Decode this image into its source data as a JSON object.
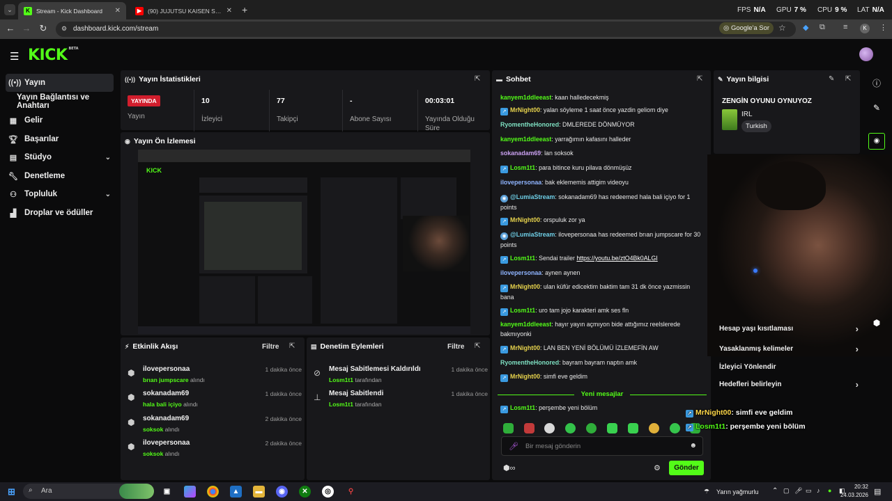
{
  "browser": {
    "tabs": [
      {
        "title": "Stream - Kick Dashboard",
        "favicon": "K",
        "active": true
      },
      {
        "title": "(90) JUJUTSU KAISEN Sendai Co...",
        "favicon": "youtube-icon",
        "active": false
      }
    ],
    "perf": [
      {
        "label": "FPS",
        "value": "N/A"
      },
      {
        "label": "GPU",
        "value": "7 %"
      },
      {
        "label": "CPU",
        "value": "9 %"
      },
      {
        "label": "LAT",
        "value": "N/A"
      }
    ],
    "url": "dashboard.kick.com/stream",
    "google_button": "Google'a Sor",
    "profile_initial": "K"
  },
  "app": {
    "logo": "KICK",
    "logo_badge": "BETA",
    "sidebar": [
      {
        "label": "Yayın",
        "icon": "broadcast-icon",
        "active": true
      },
      {
        "label": "Yayın Bağlantısı ve Anahtarı",
        "icon": "",
        "active": false
      },
      {
        "label": "Gelir",
        "icon": "revenue-icon",
        "active": false
      },
      {
        "label": "Başarılar",
        "icon": "trophy-icon",
        "active": false
      },
      {
        "label": "Stüdyo",
        "icon": "studio-icon",
        "active": false,
        "expandable": true
      },
      {
        "label": "Denetleme",
        "icon": "wrench-icon",
        "active": false
      },
      {
        "label": "Topluluk",
        "icon": "community-icon",
        "active": false,
        "expandable": true
      },
      {
        "label": "Droplar ve ödüller",
        "icon": "drops-icon",
        "active": false
      }
    ],
    "stats": {
      "title": "Yayın İstatistikleri",
      "live_badge": "YAYINDA",
      "columns": [
        {
          "value": "",
          "label": "Yayın"
        },
        {
          "value": "10",
          "label": "İzleyici"
        },
        {
          "value": "77",
          "label": "Takipçi"
        },
        {
          "value": "-",
          "label": "Abone Sayısı"
        },
        {
          "value": "00:03:01",
          "label": "Yayında Olduğu Süre"
        }
      ]
    },
    "preview": {
      "title": "Yayın Ön İzlemesi"
    },
    "activity": {
      "title": "Etkinlik Akışı",
      "filter": "Filtre",
      "items": [
        {
          "user": "ilovepersonaa",
          "reward": "brıan jumpscare",
          "suffix": "alındı",
          "time": "1 dakika önce"
        },
        {
          "user": "sokanadam69",
          "reward": "hala bali içiyo",
          "suffix": "alındı",
          "time": "1 dakika önce"
        },
        {
          "user": "sokanadam69",
          "reward": "soksok",
          "suffix": "alındı",
          "time": "2 dakika önce"
        },
        {
          "user": "ilovepersonaa",
          "reward": "soksok",
          "suffix": "alındı",
          "time": "2 dakika önce"
        }
      ]
    },
    "moderation": {
      "title": "Denetim Eylemleri",
      "filter": "Filtre",
      "items": [
        {
          "action": "Mesaj Sabitlemesi Kaldırıldı",
          "user": "Losm1t1",
          "suffix": "tarafından",
          "time": "1 dakika önce",
          "icon": "unpin-icon"
        },
        {
          "action": "Mesaj Sabitlendi",
          "user": "Losm1t1",
          "suffix": "tarafından",
          "time": "1 dakika önce",
          "icon": "pin-icon"
        }
      ]
    },
    "chat": {
      "title": "Sohbet",
      "messages": [
        {
          "user": "kanyem1ddleeast",
          "color": "#53fc18",
          "badge": "",
          "text": "kaan halledecekmiş"
        },
        {
          "user": "MrNight00",
          "color": "#e8d44d",
          "badge": "bi",
          "text": "yalan söyleme 1 saat önce yazdin geliom diye"
        },
        {
          "user": "RyomentheHonored",
          "color": "#7ee0c2",
          "badge": "",
          "text": "DMLEREDE DÖNMÜYOR"
        },
        {
          "user": "kanyem1ddleeast",
          "color": "#53fc18",
          "badge": "",
          "text": "yarrağımın kafasını halleder"
        },
        {
          "user": "sokanadam69",
          "color": "#c9a0f0",
          "badge": "",
          "text": "lan soksok"
        },
        {
          "user": "Losm1t1",
          "color": "#53fc18",
          "badge": "bi",
          "text": "para bitince kuru pilava dönmüşüz"
        },
        {
          "user": "ilovepersonaa",
          "color": "#8fb4ff",
          "badge": "",
          "text": "bak eklememis attigim videoyu"
        },
        {
          "user": "@LumiaStream",
          "color": "#6fd0e8",
          "badge": "bot",
          "text": "sokanadam69 has redeemed hala bali içiyo for 1 points"
        },
        {
          "user": "MrNight00",
          "color": "#e8d44d",
          "badge": "bi",
          "text": "orspuluk zor ya"
        },
        {
          "user": "@LumiaStream",
          "color": "#6fd0e8",
          "badge": "bot",
          "text": "ilovepersonaa has redeemed brıan jumpscare for 30 points"
        },
        {
          "user": "Losm1t1",
          "color": "#53fc18",
          "badge": "bi",
          "text": "Sendai trailer ",
          "link": "https://youtu.be/ztO4Bk0ALGI"
        },
        {
          "user": "ilovepersonaa",
          "color": "#8fb4ff",
          "badge": "",
          "text": "aynen aynen"
        },
        {
          "user": "MrNight00",
          "color": "#e8d44d",
          "badge": "bi",
          "text": "ulan küfür edicektim baktim tam 31 dk önce yazmissin bana"
        },
        {
          "user": "Losm1t1",
          "color": "#53fc18",
          "badge": "bi",
          "text": "uro tam jojo karakteri amk ses fln"
        },
        {
          "user": "kanyem1ddleeast",
          "color": "#53fc18",
          "badge": "",
          "text": "hayır yayın açmıyon bide attığımız reelslerede bakmıyonki"
        },
        {
          "user": "MrNight00",
          "color": "#e8d44d",
          "badge": "bi",
          "text": "LAN BEN YENİ BÖLÜMÜ İZLEMEFİN AW"
        },
        {
          "user": "RyomentheHonored",
          "color": "#7ee0c2",
          "badge": "",
          "text": "bayram bayram naptın amk"
        },
        {
          "user": "MrNight00",
          "color": "#e8d44d",
          "badge": "bi",
          "text": "simfi eve geldim"
        }
      ],
      "new_messages_label": "Yeni mesajlar",
      "after_divider": [
        {
          "user": "Losm1t1",
          "color": "#53fc18",
          "badge": "bi",
          "text": "perşembe yeni bölüm"
        }
      ],
      "input_placeholder": "Bir mesaj gönderin",
      "send_label": "Gönder"
    },
    "stream_info": {
      "title": "Yayın bilgisi",
      "stream_title": "ZENGİN OYUNU OYNUYOZ",
      "category": "IRL",
      "language": "Turkish"
    },
    "settings": [
      {
        "label": "Hesap yaşı kısıtlaması",
        "chevron": true
      },
      {
        "label": "Yasaklanmış kelimeler",
        "chevron": true
      },
      {
        "label": "İzleyici Yönlendir",
        "chevron": false
      },
      {
        "label": "Hedefleri belirleyin",
        "chevron": true
      }
    ],
    "overlay": [
      {
        "user": "MrNight00",
        "text": ": simfi eve geldim"
      },
      {
        "user": "Losm1t1",
        "text": ": perşembe yeni bölüm"
      }
    ]
  },
  "taskbar": {
    "search_placeholder": "Ara",
    "weather": "Yarın yağmurlu",
    "time": "20:32",
    "date": "24.03.2026"
  }
}
